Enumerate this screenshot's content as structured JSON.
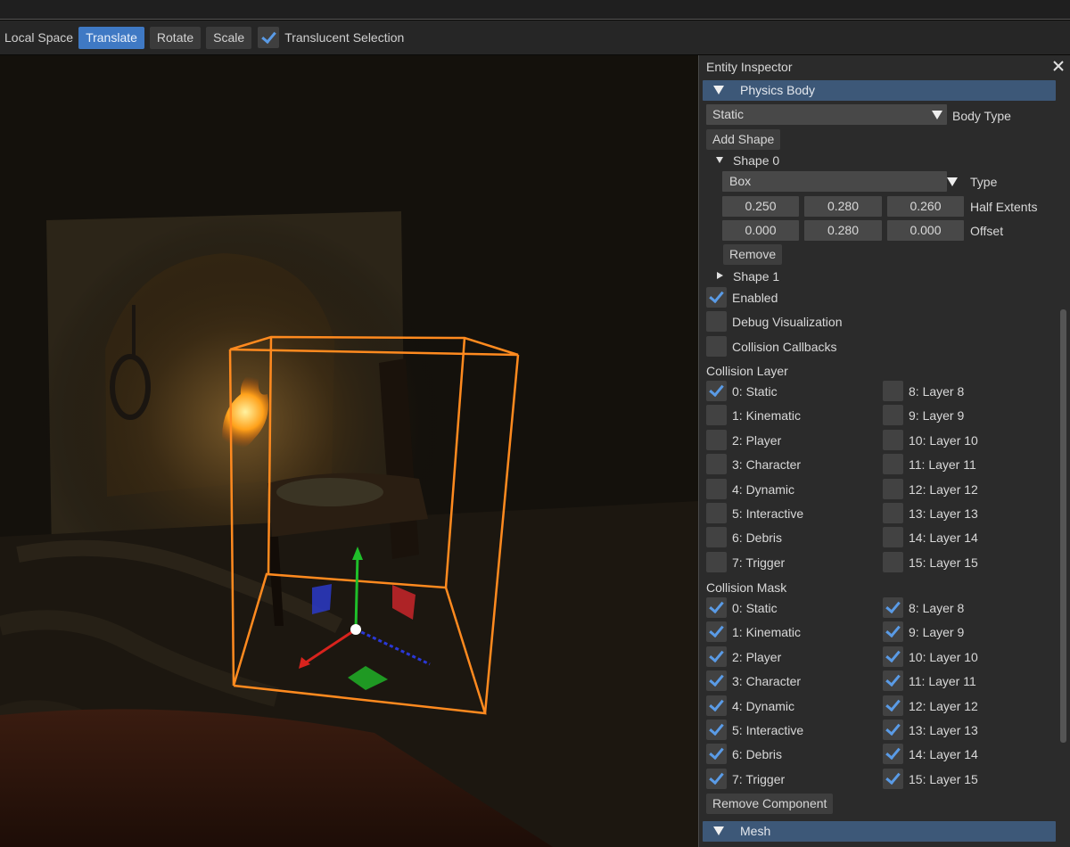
{
  "toolbar": {
    "local_space": "Local Space",
    "translate": "Translate",
    "rotate": "Rotate",
    "scale": "Scale",
    "translucent_selection": "Translucent Selection",
    "translucent_checked": true
  },
  "inspector": {
    "title": "Entity Inspector",
    "physics_body": {
      "header": "Physics Body",
      "body_type_value": "Static",
      "body_type_label": "Body Type",
      "add_shape": "Add Shape",
      "shape0": {
        "label": "Shape 0",
        "type_value": "Box",
        "type_label": "Type",
        "half_extents": [
          "0.250",
          "0.280",
          "0.260"
        ],
        "half_extents_label": "Half Extents",
        "offset": [
          "0.000",
          "0.280",
          "0.000"
        ],
        "offset_label": "Offset",
        "remove": "Remove"
      },
      "shape1": {
        "label": "Shape 1"
      },
      "enabled": {
        "label": "Enabled",
        "checked": true
      },
      "debug_visualization": {
        "label": "Debug Visualization",
        "checked": false
      },
      "collision_callbacks": {
        "label": "Collision Callbacks",
        "checked": false
      },
      "collision_layer": {
        "title": "Collision Layer",
        "left": [
          "0: Static",
          "1: Kinematic",
          "2: Player",
          "3: Character",
          "4: Dynamic",
          "5: Interactive",
          "6: Debris",
          "7: Trigger"
        ],
        "right": [
          "8: Layer 8",
          "9: Layer 9",
          "10: Layer 10",
          "11: Layer 11",
          "12: Layer 12",
          "13: Layer 13",
          "14: Layer 14",
          "15: Layer 15"
        ],
        "left_checked": [
          true,
          false,
          false,
          false,
          false,
          false,
          false,
          false
        ],
        "right_checked": [
          false,
          false,
          false,
          false,
          false,
          false,
          false,
          false
        ]
      },
      "collision_mask": {
        "title": "Collision Mask",
        "left": [
          "0: Static",
          "1: Kinematic",
          "2: Player",
          "3: Character",
          "4: Dynamic",
          "5: Interactive",
          "6: Debris",
          "7: Trigger"
        ],
        "right": [
          "8: Layer 8",
          "9: Layer 9",
          "10: Layer 10",
          "11: Layer 11",
          "12: Layer 12",
          "13: Layer 13",
          "14: Layer 14",
          "15: Layer 15"
        ],
        "left_checked": [
          true,
          true,
          true,
          true,
          true,
          true,
          true,
          true
        ],
        "right_checked": [
          true,
          true,
          true,
          true,
          true,
          true,
          true,
          true
        ]
      },
      "remove_component": "Remove Component"
    },
    "mesh": {
      "header": "Mesh"
    }
  },
  "colors": {
    "accent_blue": "#3f79c4",
    "section_header": "#3d5878",
    "gizmo_orange": "#ff8a1f",
    "checkmark": "#5a9be6"
  }
}
